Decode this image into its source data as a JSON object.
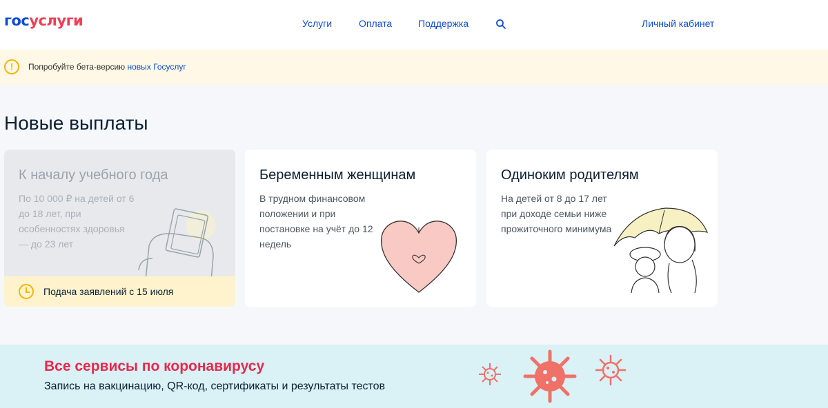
{
  "header": {
    "logo_part1": "гос",
    "logo_part2": "услуги",
    "nav": [
      "Услуги",
      "Оплата",
      "Поддержка"
    ],
    "search_icon": "search-icon",
    "account_link": "Личный кабинет"
  },
  "beta_banner": {
    "icon": "warning-icon",
    "text": "Попробуйте бета-версию ",
    "link": "новых Госуслуг"
  },
  "section": {
    "title": "Новые выплаты",
    "cards": [
      {
        "title": "К началу учебного года",
        "description": "По 10 000 ₽ на детей от 6 до 18 лет, при особенностях здоровья — до 23 лет",
        "deadline": "Подача заявлений с 15 июля",
        "illustration": "backpack-illustration"
      },
      {
        "title": "Беременным женщинам",
        "description": "В трудном финансовом положении и при постановке на учёт до 12 недель",
        "illustration": "heart-illustration"
      },
      {
        "title": "Одиноким родителям",
        "description": "На детей от 8 до 17 лет при доходе семьи ниже прожиточного минимума",
        "illustration": "umbrella-family-illustration"
      }
    ]
  },
  "covid_banner": {
    "title": "Все сервисы по коронавирусу",
    "subtitle": "Запись на вакцинацию, QR-код, сертификаты и результаты тестов",
    "icon": "virus-icon"
  },
  "colors": {
    "brand_blue": "#0d4cd3",
    "brand_red": "#ee3f58",
    "warning_yellow": "#f4b400",
    "covid_red": "#e5294d"
  }
}
